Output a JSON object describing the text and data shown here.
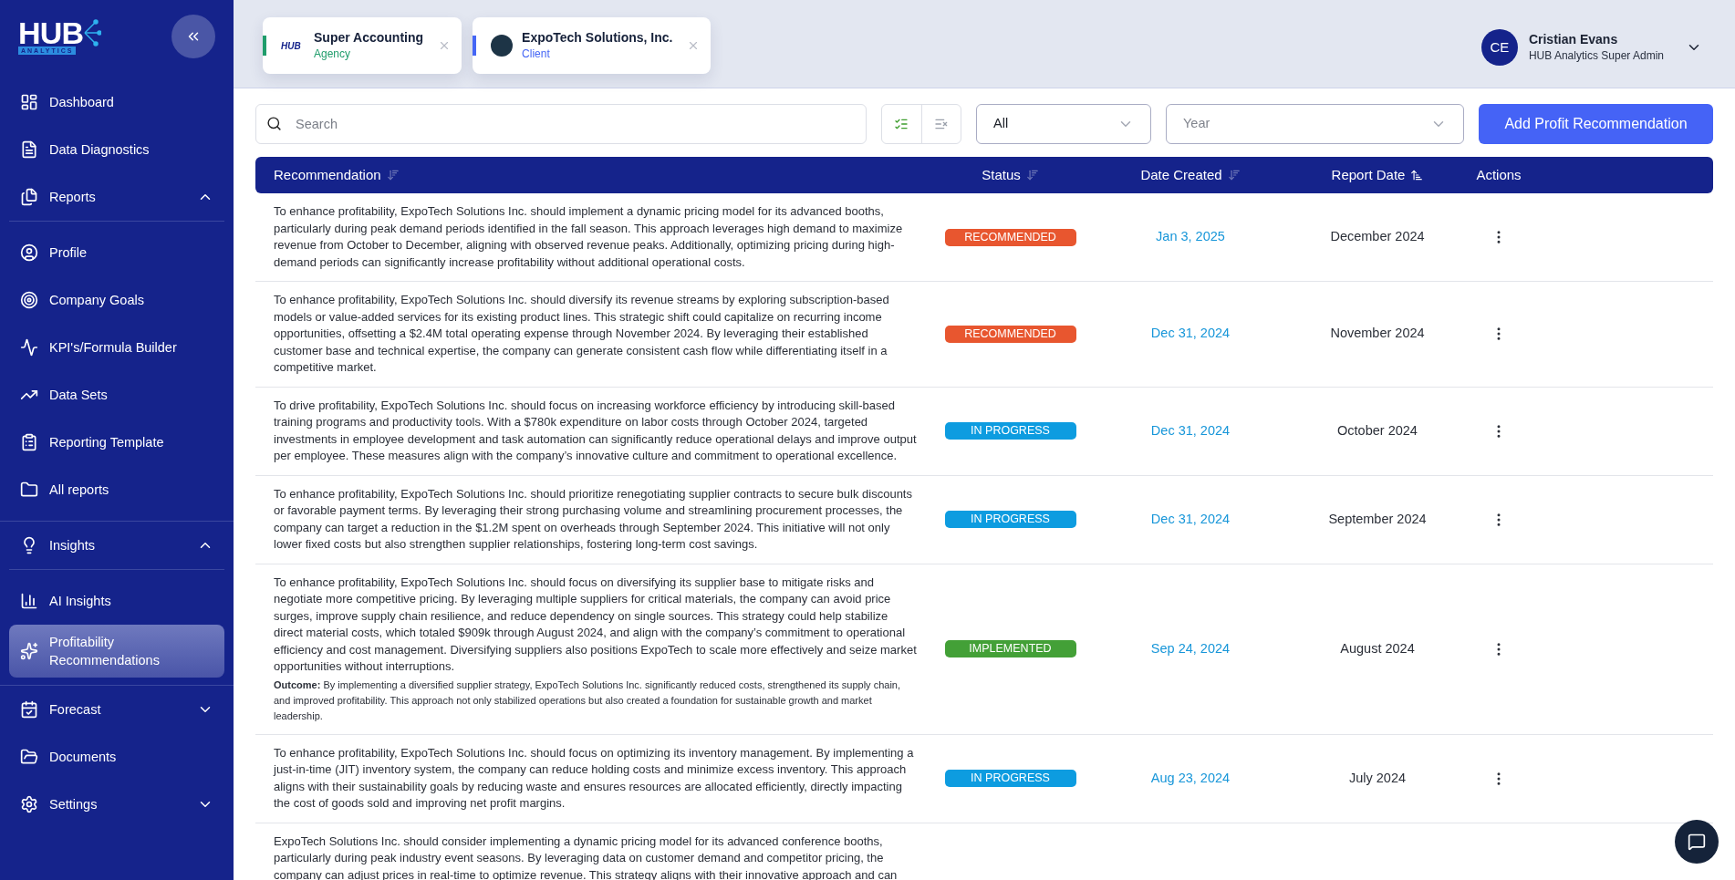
{
  "logo": {
    "text": "HUB",
    "subtitle": "ANALYTICS"
  },
  "sidebar": {
    "items": [
      {
        "kind": "link",
        "label": "Dashboard",
        "selected": false
      },
      {
        "kind": "link",
        "label": "Data Diagnostics",
        "selected": false
      },
      {
        "kind": "group",
        "label": "Reports",
        "expanded": true,
        "children": [
          {
            "label": "Profile",
            "selected": false
          },
          {
            "label": "Company Goals",
            "selected": false
          },
          {
            "label": "KPI's/Formula Builder",
            "selected": false
          },
          {
            "label": "Data Sets",
            "selected": false
          },
          {
            "label": "Reporting Template",
            "selected": false
          },
          {
            "label": "All reports",
            "selected": false
          }
        ]
      },
      {
        "kind": "group",
        "label": "Insights",
        "expanded": true,
        "children": [
          {
            "label": "AI Insights",
            "selected": false
          },
          {
            "label": "Profitability Recommendations",
            "selected": true
          }
        ]
      },
      {
        "kind": "group",
        "label": "Forecast",
        "expanded": false
      },
      {
        "kind": "link",
        "label": "Documents",
        "selected": false
      },
      {
        "kind": "group",
        "label": "Settings",
        "expanded": false
      }
    ]
  },
  "org_tabs": [
    {
      "kind": "agency",
      "logo_text": "HUB",
      "name": "Super Accounting",
      "role": "Agency",
      "color": "#1f9d6b"
    },
    {
      "kind": "client",
      "name": "ExpoTech Solutions, Inc.",
      "role": "Client",
      "color": "#4566f5"
    }
  ],
  "user": {
    "initials": "CE",
    "name": "Cristian Evans",
    "role": "HUB Analytics Super Admin"
  },
  "toolbar": {
    "search": {
      "placeholder": "Search"
    },
    "status_filter": {
      "value": "All"
    },
    "year_filter": {
      "placeholder": "Year"
    },
    "add_button": "Add Profit Recommendation"
  },
  "table": {
    "columns": [
      {
        "label": "Recommendation",
        "sorted": false
      },
      {
        "label": "Status",
        "sorted": false
      },
      {
        "label": "Date Created",
        "sorted": false
      },
      {
        "label": "Report Date",
        "sorted": true
      },
      {
        "label": "Actions"
      }
    ],
    "rows": [
      {
        "text": "To enhance profitability, ExpoTech Solutions Inc. should implement a dynamic pricing model for its advanced booths, particularly during peak demand periods identified in the fall season. This approach leverages high demand to maximize revenue from October to December, aligning with observed revenue peaks. Additionally, optimizing pricing during high-demand periods can significantly increase profitability without additional operational costs.",
        "status": {
          "label": "RECOMMENDED",
          "kind": "recommended"
        },
        "date_created": "Jan 3, 2025",
        "report_date": "December 2024"
      },
      {
        "text": "To enhance profitability, ExpoTech Solutions Inc. should diversify its revenue streams by exploring subscription-based models or value-added services for its existing product lines. This strategic shift could capitalize on recurring income opportunities, offsetting a $2.4M total operating expense through November 2024. By leveraging their established customer base and technical expertise, the company can generate consistent cash flow while differentiating itself in a competitive market.",
        "status": {
          "label": "RECOMMENDED",
          "kind": "recommended"
        },
        "date_created": "Dec 31, 2024",
        "report_date": "November 2024"
      },
      {
        "text": "To drive profitability, ExpoTech Solutions Inc. should focus on increasing workforce efficiency by introducing skill-based training programs and productivity tools. With a $780k expenditure on labor costs through October 2024, targeted investments in employee development and task automation can significantly reduce operational delays and improve output per employee. These measures align with the company’s innovative culture and commitment to operational excellence.",
        "status": {
          "label": "IN PROGRESS",
          "kind": "in_progress"
        },
        "date_created": "Dec 31, 2024",
        "report_date": "October 2024"
      },
      {
        "text": "To enhance profitability, ExpoTech Solutions Inc. should prioritize renegotiating supplier contracts to secure bulk discounts or favorable payment terms. By leveraging their strong purchasing volume and streamlining procurement processes, the company can target a reduction in the $1.2M spent on overheads through September 2024. This initiative will not only lower fixed costs but also strengthen supplier relationships, fostering long-term cost savings.",
        "status": {
          "label": "IN PROGRESS",
          "kind": "in_progress"
        },
        "date_created": "Dec 31, 2024",
        "report_date": "September 2024"
      },
      {
        "text": "To enhance profitability, ExpoTech Solutions Inc. should focus on diversifying its supplier base to mitigate risks and negotiate more competitive pricing. By leveraging multiple suppliers for critical materials, the company can avoid price surges, improve supply chain resilience, and reduce dependency on single sources. This strategy could help stabilize direct material costs, which totaled $909k through August 2024, and align with the company’s commitment to operational efficiency and cost management. Diversifying suppliers also positions ExpoTech to scale more effectively and seize market opportunities without interruptions.",
        "outcome": "**Outcome:** By implementing a diversified supplier strategy, ExpoTech Solutions Inc. significantly reduced costs, strengthened its supply chain, and improved profitability. This approach not only stabilized operations but also created a foundation for sustainable growth and market leadership.",
        "status": {
          "label": "IMPLEMENTED",
          "kind": "implemented"
        },
        "date_created": "Sep 24, 2024",
        "report_date": "August 2024"
      },
      {
        "text": "To enhance profitability, ExpoTech Solutions Inc. should focus on optimizing its inventory management. By implementing a just-in-time (JIT) inventory system, the company can reduce holding costs and minimize excess inventory. This approach aligns with their sustainability goals by reducing waste and ensures resources are allocated efficiently, directly impacting the cost of goods sold and improving net profit margins.",
        "status": {
          "label": "IN PROGRESS",
          "kind": "in_progress"
        },
        "date_created": "Aug 23, 2024",
        "report_date": "July 2024"
      },
      {
        "text": "ExpoTech Solutions Inc. should consider implementing a dynamic pricing model for its advanced conference booths, particularly during peak industry event seasons. By leveraging data on customer demand and competitor pricing, the company can adjust prices in real-time to optimize revenue. This strategy aligns with their innovative approach and can"
      }
    ]
  }
}
